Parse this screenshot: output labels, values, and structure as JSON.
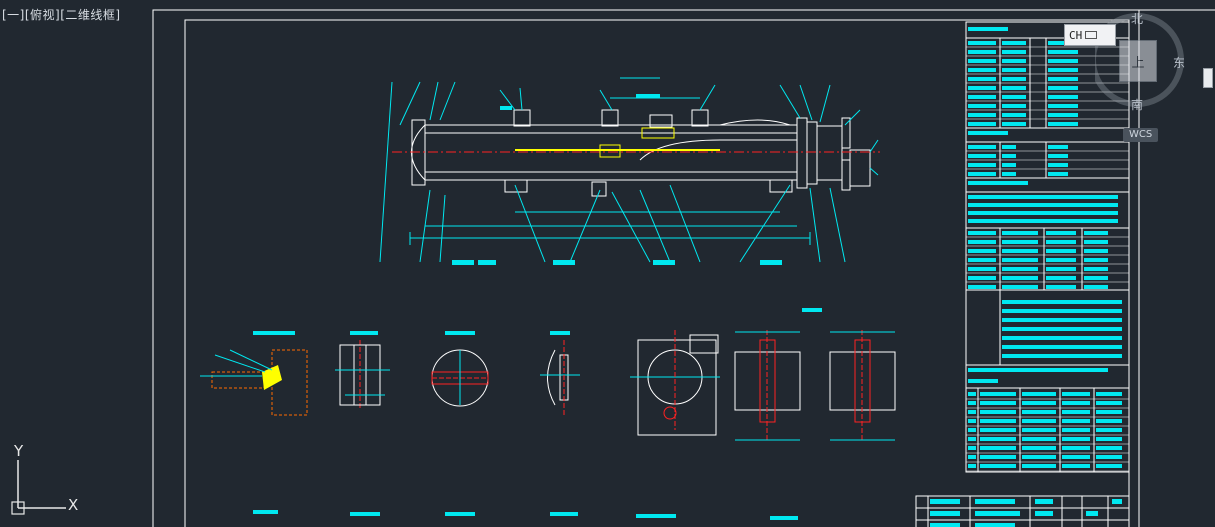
{
  "viewport": {
    "label": "[一][俯视][二维线框]"
  },
  "viewcube": {
    "face": "上",
    "north": "北",
    "south": "南",
    "east": "东",
    "wcs": "WCS"
  },
  "ime": {
    "text": "CH"
  },
  "ucs": {
    "y_label": "Y",
    "x_label": "X"
  },
  "colors": {
    "background": "#212830",
    "frame": "#ffffff",
    "cyan": "#00e8f0",
    "red": "#ff2222",
    "yellow": "#ffff00",
    "magenta": "#d040d0"
  },
  "icons": [
    "viewcube-icon",
    "ucs-icon",
    "keyboard-icon",
    "scroll-arrow-icon"
  ]
}
